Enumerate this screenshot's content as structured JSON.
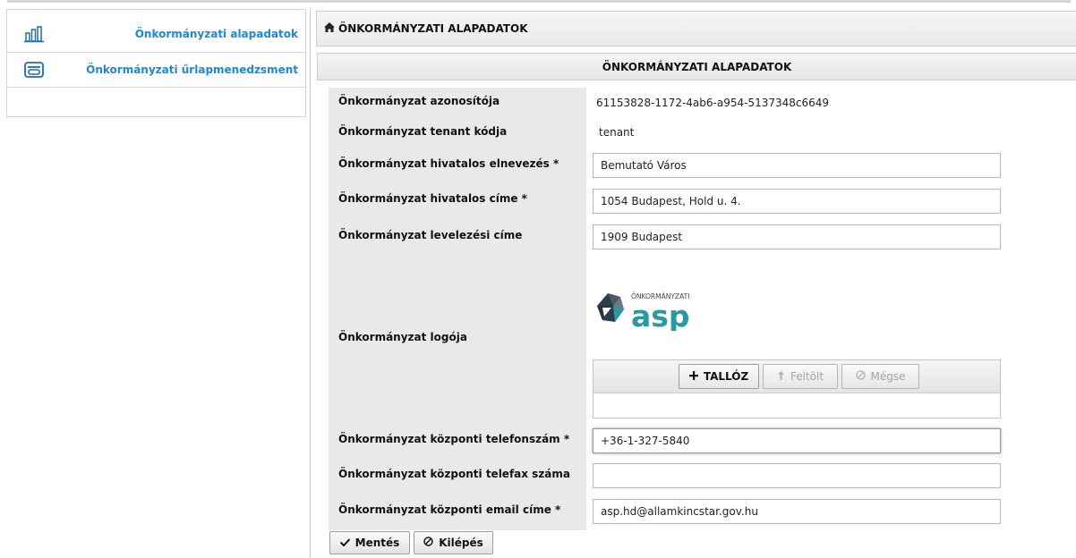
{
  "sidebar": {
    "items": [
      {
        "label": "Önkormányzati alapadatok",
        "icon": "bar-chart-icon"
      },
      {
        "label": "Önkormányzati űrlapmenedzsment",
        "icon": "form-card-icon"
      }
    ]
  },
  "page": {
    "breadcrumb_icon": "home-icon",
    "title": "ÖNKORMÁNYZATI ALAPADATOK",
    "section_title": "ÖNKORMÁNYZATI ALAPADATOK"
  },
  "form": {
    "id_label": "Önkormányzat azonosítója",
    "id_value": "61153828-1172-4ab6-a954-5137348c6649",
    "tenant_label": "Önkormányzat tenant kódja",
    "tenant_value": "tenant",
    "name_label": "Önkormányzat hivatalos elnevezés  *",
    "name_value": "Bemutató Város",
    "address_label": "Önkormányzat hivatalos címe  *",
    "address_value": "1054 Budapest, Hold u. 4.",
    "mail_label": "Önkormányzat levelezési címe",
    "mail_value": "1909 Budapest",
    "logo_label": "Önkormányzat logója",
    "logo_small_text": "ÖNKORMÁNYZATI",
    "logo_big_text": "asp",
    "phone_label": "Önkormányzat központi telefonszám  *",
    "phone_value": "+36-1-327-5840",
    "fax_label": "Önkormányzat központi telefax száma",
    "fax_value": "",
    "email_label": "Önkormányzat központi email címe  *",
    "email_value": "asp.hd@allamkincstar.gov.hu"
  },
  "uploader": {
    "browse_label": "TALLÓZ",
    "upload_label": "Feltölt",
    "cancel_label": "Mégse"
  },
  "actions": {
    "save_label": "Mentés",
    "exit_label": "Kilépés"
  },
  "colors": {
    "accent": "#1e88d6",
    "label_column_bg": "#e9e9e9",
    "logo_dark": "#2f3e4e",
    "logo_teal": "#2a9aa0"
  }
}
